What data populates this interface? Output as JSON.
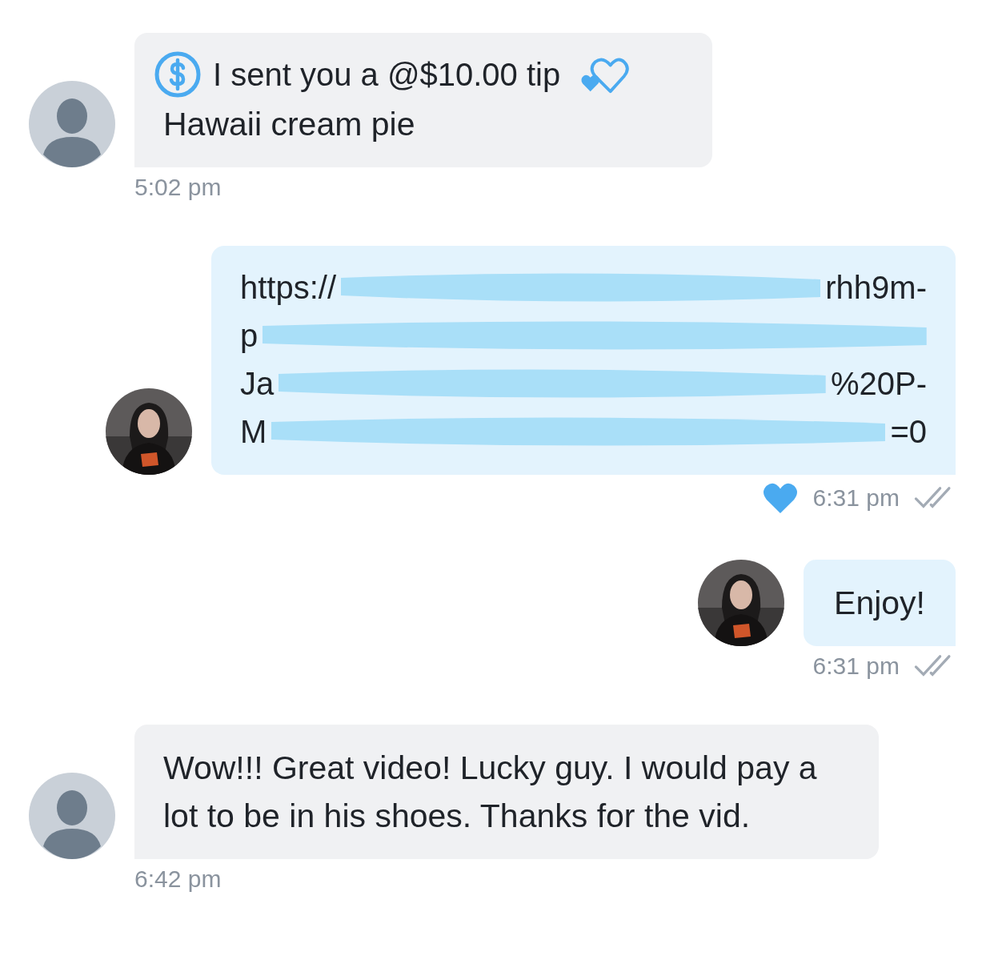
{
  "messages": [
    {
      "kind": "tip",
      "mine": false,
      "tip_text": "I sent you a @$10.00 tip",
      "text": "Hawaii cream pie",
      "time": "5:02 pm"
    },
    {
      "kind": "link",
      "mine": true,
      "url_lines": [
        {
          "left": "https://",
          "right": "rhh9m-"
        },
        {
          "left": "p"
        },
        {
          "left": "Ja",
          "right": "%20P-"
        },
        {
          "left": "M",
          "right": "=0"
        }
      ],
      "time": "6:31 pm",
      "liked": true
    },
    {
      "kind": "text",
      "mine": true,
      "text": "Enjoy!",
      "time": "6:31 pm",
      "liked": false
    },
    {
      "kind": "text",
      "mine": false,
      "text": "Wow!!! Great video! Lucky guy. I would pay a lot to be in his shoes. Thanks for the vid.",
      "time": "6:42 pm"
    }
  ]
}
